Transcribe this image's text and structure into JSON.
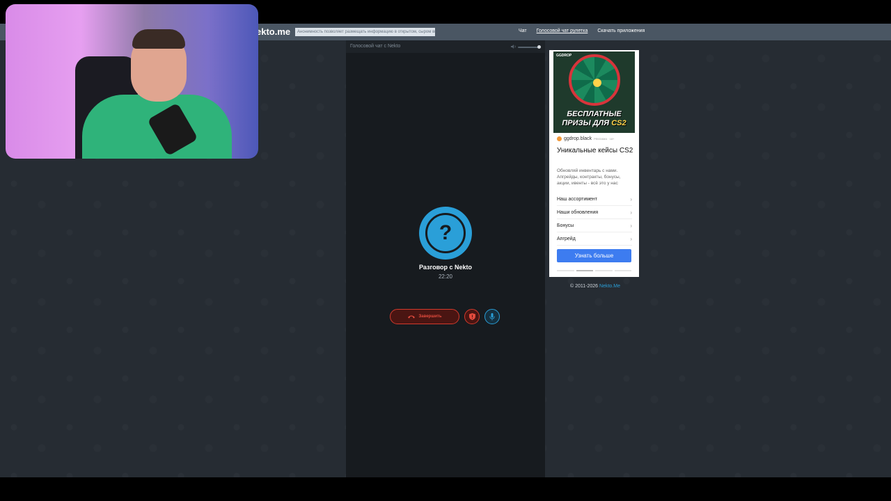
{
  "navbar": {
    "logo": "ekto.me",
    "anon_banner": "Анонимность позволяет размещать информацию в открытом, сыром виде!",
    "links": [
      {
        "label": "Чат",
        "active": false
      },
      {
        "label": "Голосовой чат рулетка",
        "active": true
      },
      {
        "label": "Скачать приложения",
        "active": false
      }
    ]
  },
  "chat": {
    "title": "Голосовой чат с Nekto",
    "avatar_symbol": "?",
    "conversation_title": "Разговор с Nekto",
    "timer": "22:20",
    "end_button_label": "Завершить",
    "volume_level": 0.93
  },
  "ad": {
    "image_logo": "GGDROP",
    "image_headline_line1": "БЕСПЛАТНЫЕ",
    "image_headline_line2_a": "ПРИЗЫ ДЛЯ",
    "image_headline_line2_b": "CS2",
    "source_name": "ggdrop.black",
    "source_tag": "РЕКЛАМА · 18+",
    "title": "Уникальные кейсы CS2",
    "description": "Обновляй инвентарь с нами. Апгрейды, контракты, бонусы, акции, ивенты - всё это у нас",
    "items": [
      "Наш ассортимент",
      "Наши обновления",
      "Бонусы",
      "Апгрейд"
    ],
    "cta": "Узнать больше"
  },
  "footer": {
    "copyright": "© 2011-2026",
    "link": "Nekto.Me"
  },
  "colors": {
    "page_bg": "#262c33",
    "navbar_bg": "#4a5663",
    "chat_bg": "#171b1f",
    "accent_blue": "#2a9fd8",
    "danger_red": "#d33a2c",
    "cta_blue": "#3d7cf0"
  }
}
